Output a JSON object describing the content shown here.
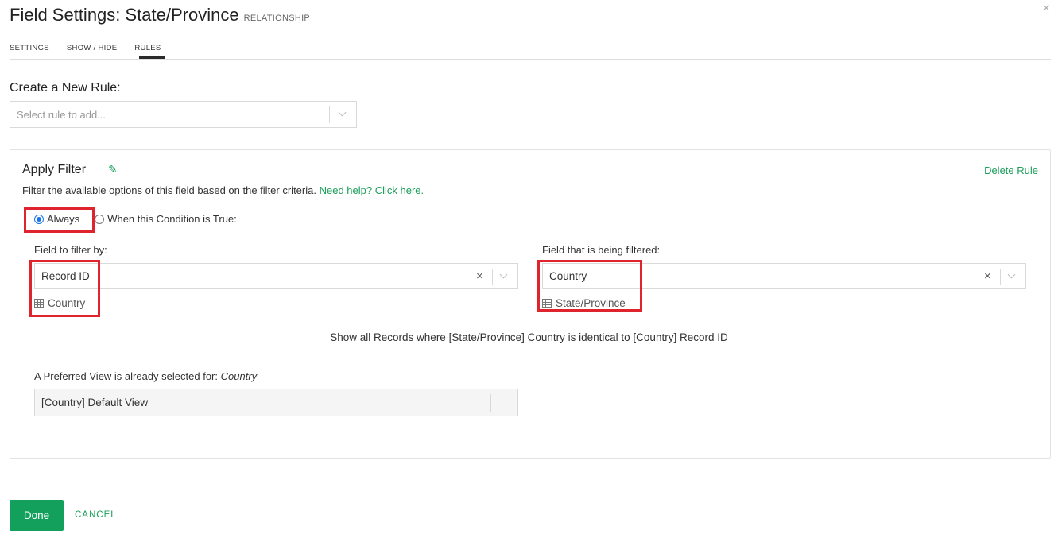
{
  "header": {
    "title": "Field Settings: State/Province",
    "subtitle": "RELATIONSHIP",
    "close_icon": "×"
  },
  "tabs": [
    {
      "label": "SETTINGS"
    },
    {
      "label": "SHOW / HIDE"
    },
    {
      "label": "RULES",
      "active": true
    }
  ],
  "create_rule": {
    "heading": "Create a New Rule:",
    "placeholder": "Select rule to add..."
  },
  "rule": {
    "title": "Apply Filter",
    "edit_icon": "✎",
    "delete_label": "Delete Rule",
    "description": "Filter the available options of this field based on the filter criteria.",
    "help_link": "Need help? Click here.",
    "options": [
      {
        "label": "Always",
        "checked": true
      },
      {
        "label": "When this Condition is True:",
        "checked": false
      }
    ],
    "filter_by": {
      "label": "Field to filter by:",
      "value": "Record ID",
      "table": "Country",
      "clear_icon": "×"
    },
    "being_filtered": {
      "label": "Field that is being filtered:",
      "value": "Country",
      "table": "State/Province",
      "clear_icon": "×"
    },
    "summary": "Show all Records where [State/Province] Country is identical to [Country] Record ID",
    "preferred_view": {
      "label": "A Preferred View is already selected for:",
      "label_table": "Country",
      "value": "[Country] Default View"
    }
  },
  "footer": {
    "done_label": "Done",
    "cancel_label": "CANCEL"
  },
  "colors": {
    "accent": "#12a05c",
    "highlight": "#e0242e",
    "radio": "#1a73e8"
  }
}
